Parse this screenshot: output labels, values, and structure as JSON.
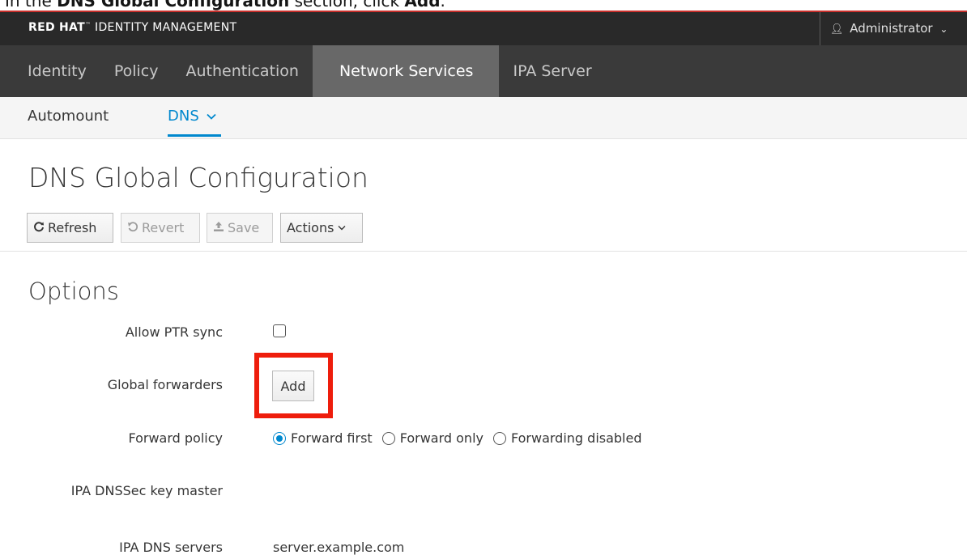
{
  "instruction": {
    "prefix": "In the ",
    "bold1": "DNS Global Configuration",
    "middle": " section, click ",
    "bold2": "Add",
    "suffix": "."
  },
  "header": {
    "brand_bold": "RED HAT",
    "brand_rest": "IDENTITY MANAGEMENT",
    "user": "Administrator",
    "accent_color": "#c9302c"
  },
  "main_nav": {
    "items": [
      {
        "label": "Identity"
      },
      {
        "label": "Policy"
      },
      {
        "label": "Authentication"
      },
      {
        "label": "Network Services",
        "active": true
      },
      {
        "label": "IPA Server"
      }
    ]
  },
  "sub_nav": {
    "items": [
      {
        "label": "Automount"
      },
      {
        "label": "DNS",
        "active": true
      }
    ],
    "active_color": "#0088ce"
  },
  "page": {
    "title": "DNS Global Configuration"
  },
  "toolbar": {
    "refresh": "Refresh",
    "revert": "Revert",
    "save": "Save",
    "actions": "Actions"
  },
  "options": {
    "title": "Options",
    "allow_ptr_sync": {
      "label": "Allow PTR sync",
      "checked": false
    },
    "global_forwarders": {
      "label": "Global forwarders",
      "add_label": "Add"
    },
    "forward_policy": {
      "label": "Forward policy",
      "options": [
        "Forward first",
        "Forward only",
        "Forwarding disabled"
      ],
      "selected": "Forward first"
    },
    "dnssec_key_master": {
      "label": "IPA DNSSec key master",
      "value": ""
    },
    "dns_servers": {
      "label": "IPA DNS servers",
      "value": "server.example.com"
    }
  },
  "highlight_color": "#ee1d0c"
}
